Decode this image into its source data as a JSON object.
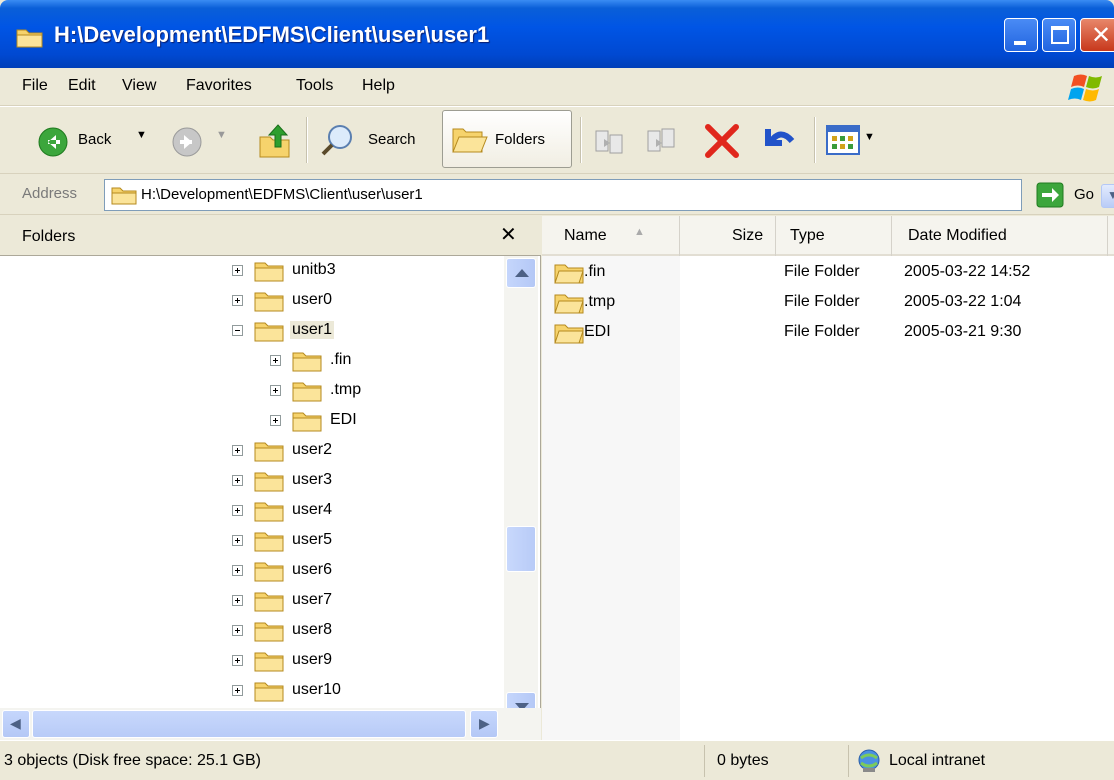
{
  "window": {
    "title": "H:\\Development\\EDFMS\\Client\\user\\user1"
  },
  "menu": [
    "File",
    "Edit",
    "View",
    "Favorites",
    "Tools",
    "Help"
  ],
  "toolbar": {
    "back_label": "Back",
    "search_label": "Search",
    "folders_label": "Folders"
  },
  "address": {
    "label": "Address",
    "value": "H:\\Development\\EDFMS\\Client\\user\\user1",
    "go_label": "Go"
  },
  "folders_pane": {
    "title": "Folders",
    "tree": [
      {
        "label": "unitb3",
        "expanded": false
      },
      {
        "label": "user0",
        "expanded": false
      },
      {
        "label": "user1",
        "expanded": true,
        "selected": true
      },
      {
        "label": ".fin",
        "expanded": false,
        "child": true
      },
      {
        "label": ".tmp",
        "expanded": false,
        "child": true
      },
      {
        "label": "EDI",
        "expanded": false,
        "child": true
      },
      {
        "label": "user2",
        "expanded": false
      },
      {
        "label": "user3",
        "expanded": false
      },
      {
        "label": "user4",
        "expanded": false
      },
      {
        "label": "user5",
        "expanded": false
      },
      {
        "label": "user6",
        "expanded": false
      },
      {
        "label": "user7",
        "expanded": false
      },
      {
        "label": "user8",
        "expanded": false
      },
      {
        "label": "user9",
        "expanded": false
      },
      {
        "label": "user10",
        "expanded": false
      }
    ]
  },
  "file_list": {
    "columns": [
      "Name",
      "Size",
      "Type",
      "Date Modified"
    ],
    "rows": [
      {
        "name": ".fin",
        "size": "",
        "type": "File Folder",
        "date": "2005-03-22 14:52"
      },
      {
        "name": ".tmp",
        "size": "",
        "type": "File Folder",
        "date": "2005-03-22 1:04"
      },
      {
        "name": "EDI",
        "size": "",
        "type": "File Folder",
        "date": "2005-03-21 9:30"
      }
    ]
  },
  "status": {
    "objects": "3 objects (Disk free space: 25.1 GB)",
    "size": "0 bytes",
    "zone": "Local intranet"
  }
}
